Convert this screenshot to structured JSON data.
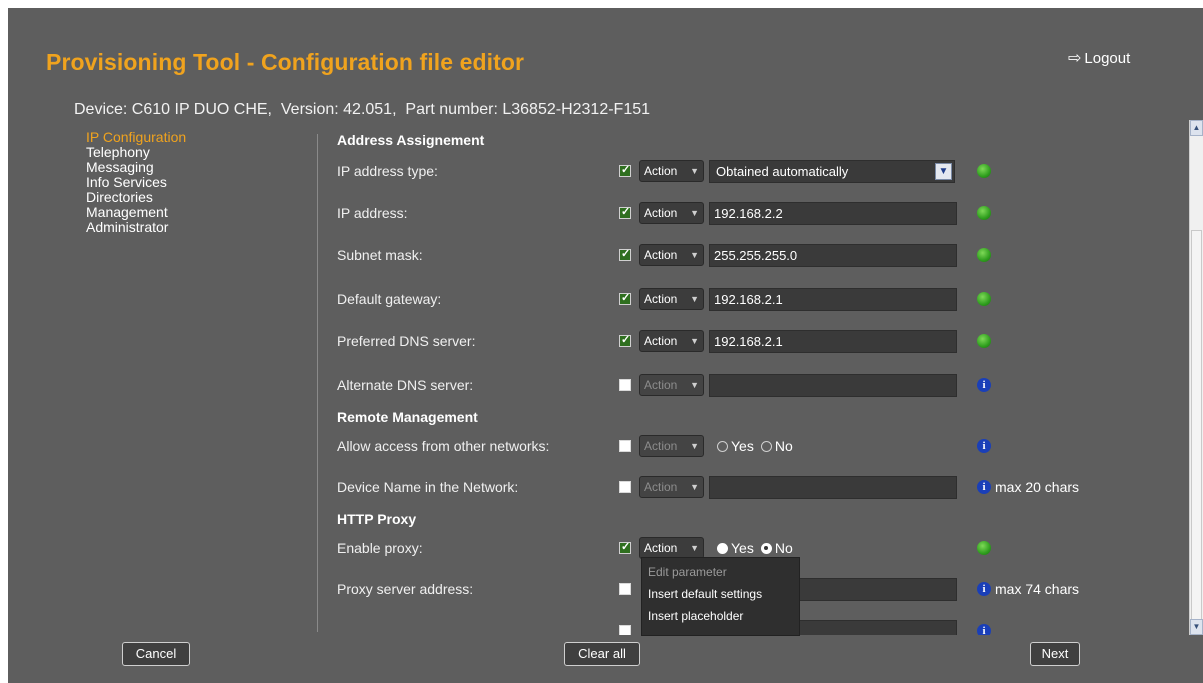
{
  "header": {
    "title": "Provisioning Tool - Configuration file editor",
    "logout_label": "Logout",
    "device_info": "Device: C610 IP DUO CHE,  Version: 42.051,  Part number: L36852-H2312-F151"
  },
  "sidebar": {
    "items": [
      {
        "label": "IP Configuration",
        "active": true
      },
      {
        "label": "Telephony"
      },
      {
        "label": "Messaging"
      },
      {
        "label": "Info Services"
      },
      {
        "label": "Directories"
      },
      {
        "label": "Management"
      },
      {
        "label": "Administrator"
      }
    ]
  },
  "sections": {
    "address": "Address Assignement",
    "remote": "Remote Management",
    "proxy": "HTTP Proxy"
  },
  "action_label": "Action",
  "rows": {
    "ip_type": {
      "label": "IP address type:",
      "checked": true,
      "value": "Obtained automatically"
    },
    "ip_address": {
      "label": "IP address:",
      "checked": true,
      "value": "192.168.2.2"
    },
    "subnet": {
      "label": "Subnet mask:",
      "checked": true,
      "value": "255.255.255.0"
    },
    "gateway": {
      "label": "Default gateway:",
      "checked": true,
      "value": "192.168.2.1"
    },
    "pref_dns": {
      "label": "Preferred DNS server:",
      "checked": true,
      "value": "192.168.2.1"
    },
    "alt_dns": {
      "label": "Alternate DNS server:",
      "checked": false,
      "value": ""
    },
    "allow_access": {
      "label": "Allow access from other networks:",
      "checked": false,
      "yes": "Yes",
      "no": "No"
    },
    "device_name": {
      "label": "Device Name in the Network:",
      "checked": false,
      "value": "",
      "hint": "max 20 chars"
    },
    "enable_proxy": {
      "label": "Enable proxy:",
      "checked": true,
      "yes": "Yes",
      "no": "No",
      "selected": "No"
    },
    "proxy_address": {
      "label": "Proxy server address:",
      "checked": false,
      "value": "",
      "hint": "max 74 chars"
    }
  },
  "action_menu": {
    "items": [
      "Edit parameter",
      "Insert default settings",
      "Insert placeholder"
    ]
  },
  "footer": {
    "cancel": "Cancel",
    "clear_all": "Clear all",
    "next": "Next"
  },
  "colors": {
    "accent": "#f0a31e",
    "background": "#5e5e5e",
    "ok": "#2f9e1e",
    "info": "#1a3fb8"
  }
}
